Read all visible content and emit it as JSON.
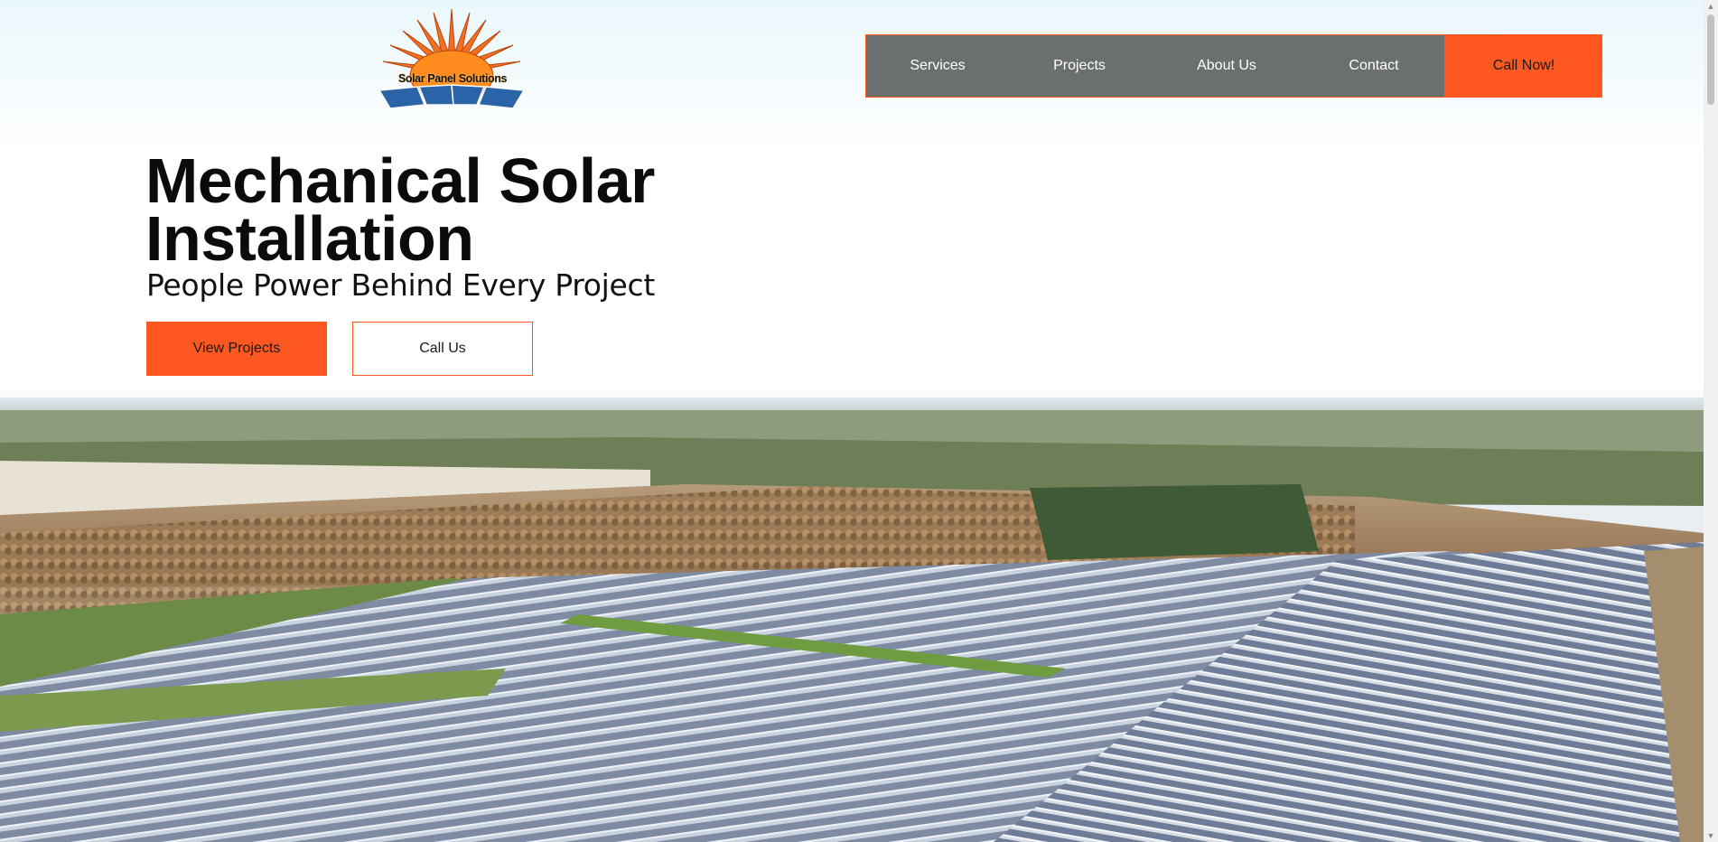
{
  "logo": {
    "text": "Solar Panel Solutions"
  },
  "nav": {
    "items": [
      {
        "label": "Services"
      },
      {
        "label": "Projects"
      },
      {
        "label": "About Us"
      },
      {
        "label": "Contact"
      }
    ],
    "cta_label": "Call Now!"
  },
  "hero": {
    "title": "Mechanical Solar Installation",
    "subtitle": "People Power Behind Every Project",
    "primary_button": "View Projects",
    "secondary_button": "Call Us",
    "image": "aerial-solar-farm-photo"
  },
  "colors": {
    "accent": "#ff5722",
    "nav_bg": "#6b6f70",
    "text": "#0b0b0b"
  }
}
